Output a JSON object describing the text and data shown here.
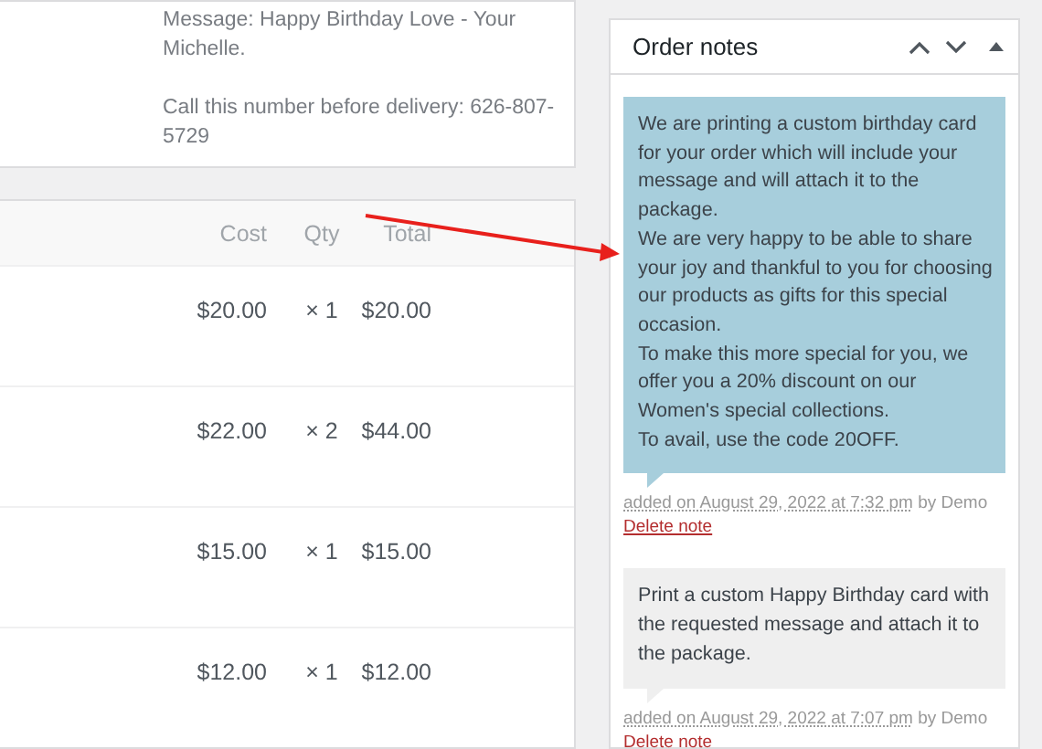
{
  "customer_note": {
    "lines": [
      "Message: Happy Birthday Love - Your Michelle.",
      "Call this number before delivery: 626-807-5729"
    ]
  },
  "items": {
    "columns": [
      "Cost",
      "Qty",
      "Total"
    ],
    "rows": [
      {
        "cost": "$20.00",
        "qty": "× 1",
        "total": "$20.00"
      },
      {
        "cost": "$22.00",
        "qty": "× 2",
        "total": "$44.00"
      },
      {
        "cost": "$15.00",
        "qty": "× 1",
        "total": "$15.00"
      },
      {
        "cost": "$12.00",
        "qty": "× 1",
        "total": "$12.00"
      }
    ]
  },
  "order_notes": {
    "title": "Order notes",
    "notes": [
      {
        "kind": "customer",
        "lines": [
          "We are printing a custom birthday card for your order which will include your message and will attach it to the package.",
          "We are very happy to be able to share your joy and thankful to you for choosing our products as gifts for this special occasion.",
          "To make this more special for you, we offer you a 20% discount on our Women's special collections.",
          "To avail, use the code 20OFF."
        ],
        "added": "added on August 29, 2022 at 7:32 pm",
        "author": "by Demo",
        "delete": "Delete note"
      },
      {
        "kind": "private",
        "lines": [
          "Print a custom Happy Birthday card with the requested message and attach it to the package."
        ],
        "added": "added on August 29, 2022 at 7:07 pm",
        "author": "by Demo",
        "delete": "Delete note"
      }
    ]
  }
}
